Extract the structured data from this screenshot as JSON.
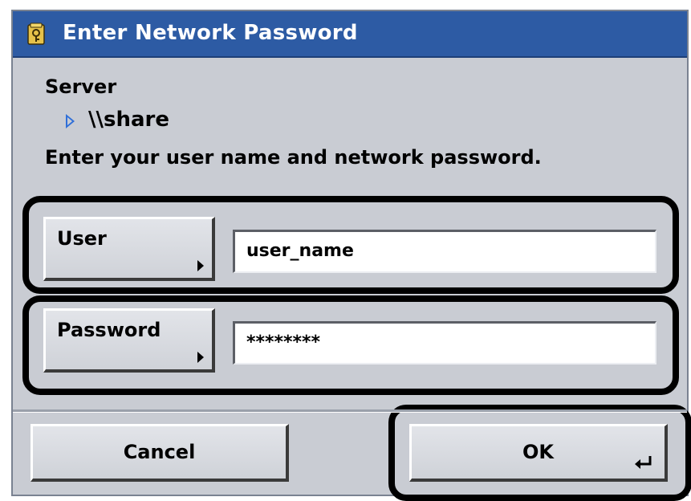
{
  "dialog": {
    "title": "Enter Network Password",
    "icon": "folder-key-icon"
  },
  "server": {
    "label": "Server",
    "path": "\\\\share",
    "arrow_icon": "play-arrow-icon"
  },
  "instruction": "Enter your user name and network password.",
  "fields": {
    "user": {
      "label": "User",
      "value": "user_name"
    },
    "password": {
      "label": "Password",
      "value": "********"
    }
  },
  "actions": {
    "cancel": "Cancel",
    "ok": "OK",
    "ok_icon": "enter-key-icon"
  },
  "colors": {
    "titlebar": "#2d5ba4",
    "dialog_bg": "#c9ccd3",
    "highlight": "#000000",
    "arrow": "#2f6fd8"
  }
}
